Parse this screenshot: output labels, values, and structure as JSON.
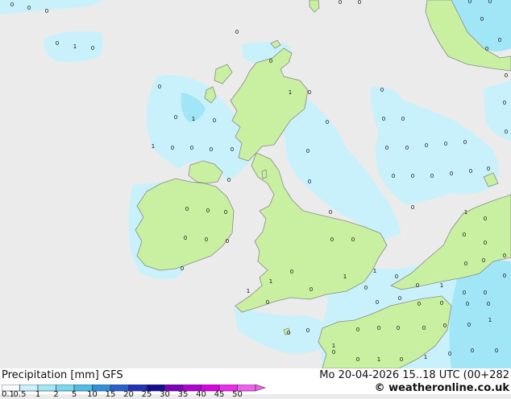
{
  "footer": {
    "legend_title": "Precipitation [mm]  GFS",
    "run_info": "Mo 20-04-2026 15..18 UTC (00+282",
    "credit": "© weatheronline.co.uk"
  },
  "legend": {
    "ticks": [
      "0.1",
      "0.5",
      "1",
      "2",
      "5",
      "10",
      "15",
      "20",
      "25",
      "30",
      "35",
      "40",
      "45",
      "50"
    ],
    "colors": [
      "#f5fbff",
      "#c8f1fb",
      "#a0e6f7",
      "#78d8f0",
      "#4cbfe6",
      "#2e8fdc",
      "#2a5fd0",
      "#1f34b8",
      "#12108f",
      "#7e00bf",
      "#b000d4",
      "#d800e0",
      "#ee28ee",
      "#f060f0"
    ]
  },
  "map": {
    "colors": {
      "sea": "#ebebeb",
      "land": "#c8f0a0",
      "rain_light": "#c8f1fb",
      "rain_mid": "#a0e6f7",
      "coast": "#8a8a8a"
    },
    "values": [
      "0",
      "0",
      "0",
      "0",
      "0",
      "0",
      "0",
      "0",
      "1",
      "0",
      "0",
      "0",
      "0",
      "1",
      "0",
      "1",
      "0",
      "0",
      "0",
      "0",
      "0",
      "1",
      "0",
      "0",
      "0",
      "0",
      "0",
      "0",
      "0",
      "0",
      "0",
      "0",
      "0",
      "0",
      "0",
      "0",
      "0",
      "0",
      "0",
      "0",
      "0",
      "0",
      "0",
      "0",
      "0",
      "0",
      "0",
      "0",
      "0",
      "0",
      "0",
      "0",
      "0",
      "0",
      "0",
      "0",
      "0",
      "0",
      "1",
      "0",
      "0",
      "0",
      "0",
      "0",
      "0",
      "0",
      "1",
      "0",
      "0",
      "1",
      "0",
      "0",
      "0",
      "0",
      "0",
      "0",
      "0",
      "0",
      "0",
      "0",
      "0",
      "0",
      "0",
      "0",
      "1",
      "0",
      "0",
      "0",
      "0",
      "0",
      "1",
      "0",
      "1",
      "0",
      "0",
      "0",
      "1",
      "0",
      "1",
      "0",
      "1",
      "0",
      "1"
    ]
  }
}
